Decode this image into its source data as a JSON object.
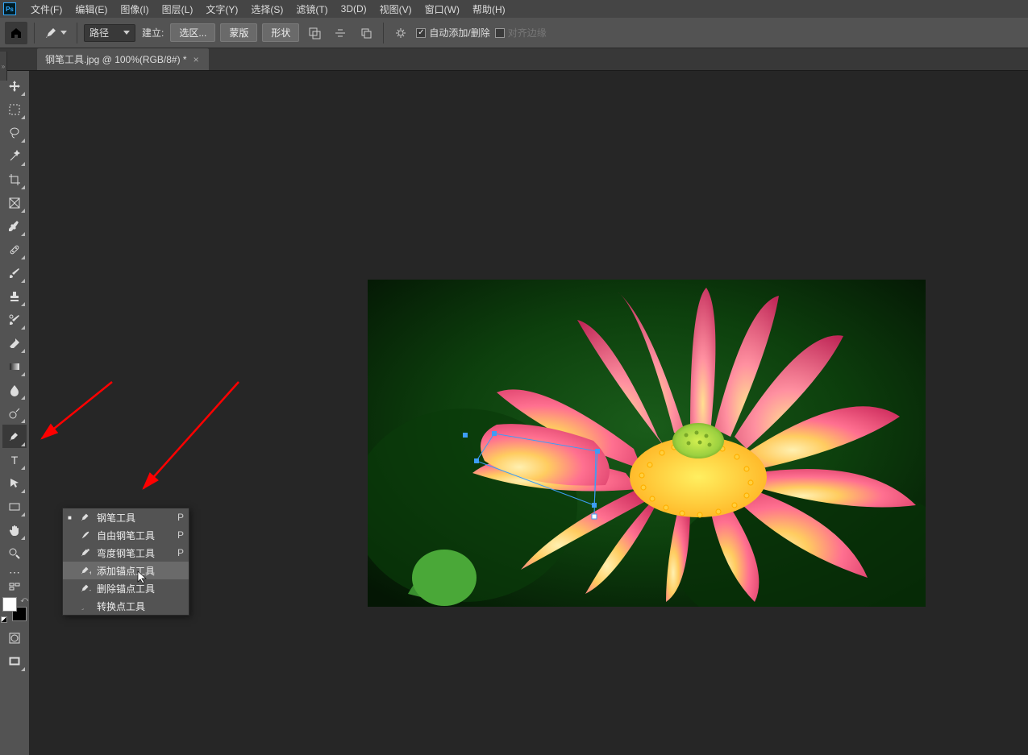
{
  "app_icon_text": "Ps",
  "menus": [
    "文件(F)",
    "编辑(E)",
    "图像(I)",
    "图层(L)",
    "文字(Y)",
    "选择(S)",
    "滤镜(T)",
    "3D(D)",
    "视图(V)",
    "窗口(W)",
    "帮助(H)"
  ],
  "options": {
    "mode_select": "路径",
    "make_label": "建立:",
    "btn_selection": "选区...",
    "btn_mask": "蒙版",
    "btn_shape": "形状",
    "auto_add_delete": "自动添加/删除",
    "align_edges": "对齐边缘"
  },
  "document_tab": "钢笔工具.jpg @ 100%(RGB/8#) *",
  "toolbar_tools": [
    {
      "name": "move-tool",
      "icon": "move"
    },
    {
      "name": "marquee-tool",
      "icon": "marquee"
    },
    {
      "name": "lasso-tool",
      "icon": "lasso"
    },
    {
      "name": "quick-select-tool",
      "icon": "wand"
    },
    {
      "name": "crop-tool",
      "icon": "crop"
    },
    {
      "name": "frame-tool",
      "icon": "frame"
    },
    {
      "name": "eyedropper-tool",
      "icon": "eyedropper"
    },
    {
      "name": "healing-tool",
      "icon": "healing"
    },
    {
      "name": "brush-tool",
      "icon": "brush"
    },
    {
      "name": "stamp-tool",
      "icon": "stamp"
    },
    {
      "name": "history-brush-tool",
      "icon": "history"
    },
    {
      "name": "eraser-tool",
      "icon": "eraser"
    },
    {
      "name": "gradient-tool",
      "icon": "gradient"
    },
    {
      "name": "blur-tool",
      "icon": "blur"
    },
    {
      "name": "dodge-tool",
      "icon": "dodge"
    },
    {
      "name": "pen-tool",
      "icon": "pen",
      "active": true
    },
    {
      "name": "type-tool",
      "icon": "type"
    },
    {
      "name": "path-select-tool",
      "icon": "pathselect"
    },
    {
      "name": "rectangle-tool",
      "icon": "rect"
    },
    {
      "name": "hand-tool",
      "icon": "hand"
    },
    {
      "name": "zoom-tool",
      "icon": "zoom"
    }
  ],
  "flyout": {
    "items": [
      {
        "selected": true,
        "label": "钢笔工具",
        "shortcut": "P",
        "icon": "pen"
      },
      {
        "selected": false,
        "label": "自由钢笔工具",
        "shortcut": "P",
        "icon": "freeform-pen"
      },
      {
        "selected": false,
        "label": "弯度钢笔工具",
        "shortcut": "P",
        "icon": "curvature-pen"
      },
      {
        "selected": false,
        "label": "添加锚点工具",
        "shortcut": "",
        "icon": "add-anchor",
        "highlight": true
      },
      {
        "selected": false,
        "label": "删除锚点工具",
        "shortcut": "",
        "icon": "delete-anchor"
      },
      {
        "selected": false,
        "label": "转换点工具",
        "shortcut": "",
        "icon": "convert-anchor"
      }
    ]
  },
  "bottom_tools": [
    "quickmask-icon",
    "screenmode-icon"
  ]
}
